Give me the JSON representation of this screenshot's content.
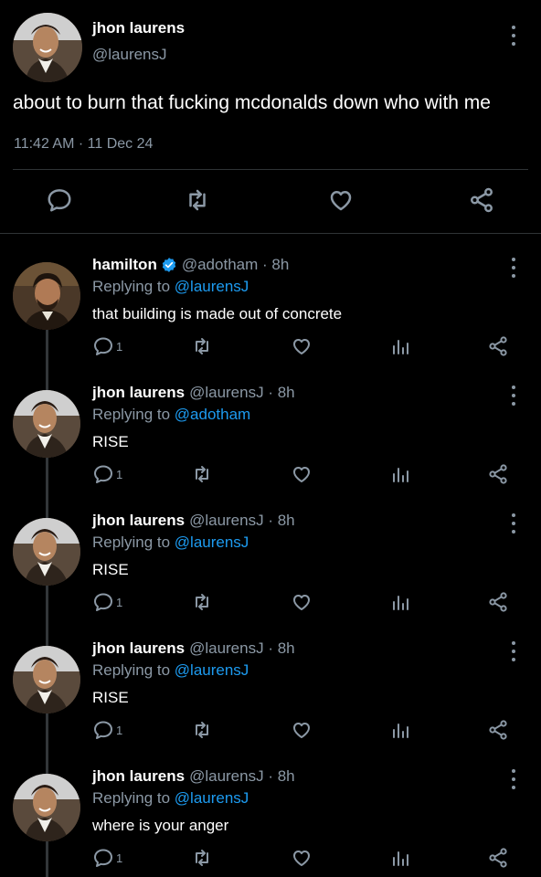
{
  "main_tweet": {
    "display_name": "jhon laurens",
    "handle": "@laurensJ",
    "text": "about to burn that fucking mcdonalds down who with me",
    "timestamp": "11:42 AM · 11 Dec 24",
    "actions": [
      "reply-icon",
      "retweet-icon",
      "like-icon",
      "share-icon"
    ]
  },
  "replies": [
    {
      "display_name": "hamilton",
      "verified": true,
      "handle_time": "@adotham · 8h",
      "replying_prefix": "Replying to ",
      "replying_to": "@laurensJ",
      "text": "that building is made out of concrete",
      "reply_count": "1"
    },
    {
      "display_name": "jhon laurens",
      "verified": false,
      "handle_time": "@laurensJ · 8h",
      "replying_prefix": "Replying to ",
      "replying_to": "@adotham",
      "text": "RISE",
      "reply_count": "1"
    },
    {
      "display_name": "jhon laurens",
      "verified": false,
      "handle_time": "@laurensJ · 8h",
      "replying_prefix": "Replying to ",
      "replying_to": "@laurensJ",
      "text": "RISE",
      "reply_count": "1"
    },
    {
      "display_name": "jhon laurens",
      "verified": false,
      "handle_time": "@laurensJ · 8h",
      "replying_prefix": "Replying to ",
      "replying_to": "@laurensJ",
      "text": "RISE",
      "reply_count": "1"
    },
    {
      "display_name": "jhon laurens",
      "verified": false,
      "handle_time": "@laurensJ · 8h",
      "replying_prefix": "Replying to ",
      "replying_to": "@laurensJ",
      "text": "where is your anger",
      "reply_count": "1"
    }
  ],
  "colors": {
    "background": "#000000",
    "text": "#ffffff",
    "secondary": "#8b98a5",
    "link": "#1d9bf0",
    "verified": "#1d9bf0",
    "divider": "#2f3336"
  }
}
